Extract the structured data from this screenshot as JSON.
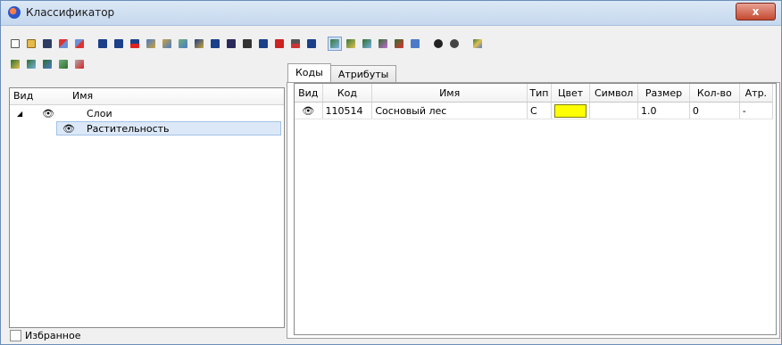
{
  "window": {
    "title": "Классификатор",
    "close_label": "x"
  },
  "toolbar1": [
    "new-file",
    "open-folder",
    "save",
    "import",
    "export",
    "table-a",
    "table-b",
    "table-c",
    "lines-a",
    "lines-b",
    "lines-c",
    "lines-d",
    "grid-a",
    "grid-b",
    "label",
    "column",
    "z-button",
    "sort-az",
    "tree",
    "edit-a",
    "edit-b",
    "edit-c",
    "edit-d",
    "edit-e",
    "ruler",
    "binoculars",
    "binoculars-alt",
    "chart"
  ],
  "toolbar2": [
    "layer-edit",
    "layer-fill",
    "layer-new",
    "layer-visibility",
    "layer-delete"
  ],
  "left": {
    "col_view": "Вид",
    "col_name": "Имя",
    "rows": [
      {
        "label": "Слои"
      },
      {
        "label": "Растительность"
      }
    ],
    "favorites_label": "Избранное"
  },
  "tabs": [
    "Коды",
    "Атрибуты"
  ],
  "table": {
    "headers": [
      "Вид",
      "Код",
      "Имя",
      "Тип",
      "Цвет",
      "Символ",
      "Размер",
      "Кол-во",
      "Атр."
    ],
    "rows": [
      {
        "view": "👁",
        "code": "110514",
        "name": "Сосновый лес",
        "type": "C",
        "color": "#ffff00",
        "symbol": "",
        "size": "1.0",
        "count": "0",
        "attr": "-"
      }
    ]
  }
}
